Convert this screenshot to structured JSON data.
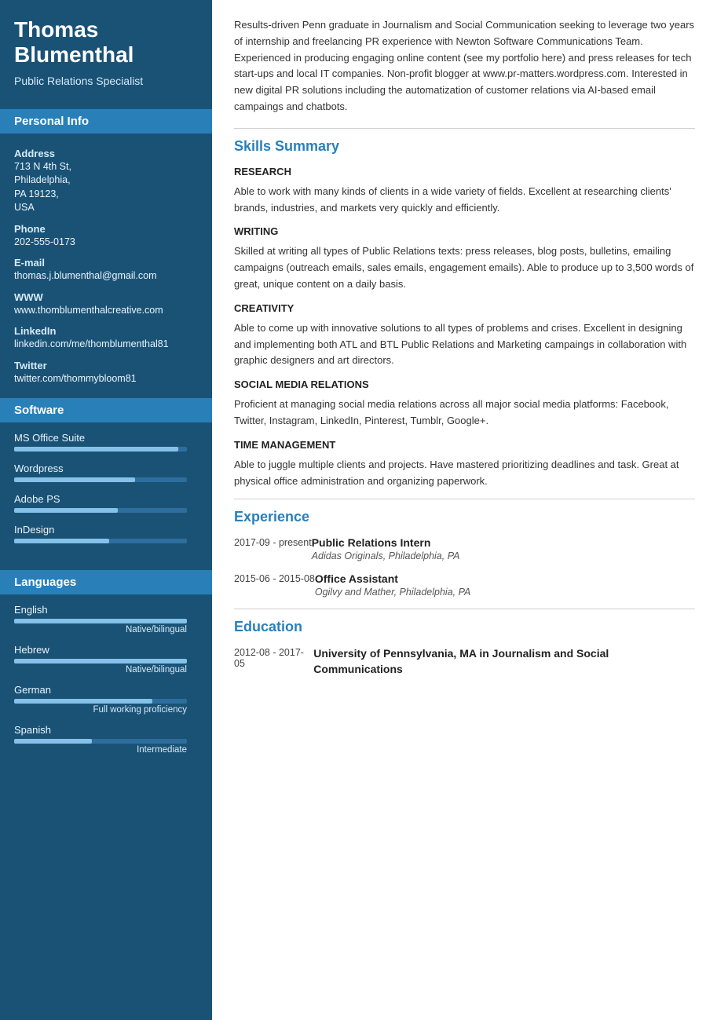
{
  "sidebar": {
    "name": "Thomas Blumenthal",
    "title": "Public Relations Specialist",
    "sections": {
      "personal_info": "Personal Info",
      "software": "Software",
      "languages": "Languages"
    },
    "personal": {
      "address_label": "Address",
      "address_value": "713 N 4th St,\nPhiladelphia,\nPA 19123,\nUSA",
      "phone_label": "Phone",
      "phone_value": "202-555-0173",
      "email_label": "E-mail",
      "email_value": "thomas.j.blumenthal@gmail.com",
      "www_label": "WWW",
      "www_value": "www.thomblumenthalcreative.com",
      "linkedin_label": "LinkedIn",
      "linkedin_value": "linkedin.com/me/thomblumenthal81",
      "twitter_label": "Twitter",
      "twitter_value": "twitter.com/thommybloom81"
    },
    "software": [
      {
        "name": "MS Office Suite",
        "percent": 95
      },
      {
        "name": "Wordpress",
        "percent": 70
      },
      {
        "name": "Adobe PS",
        "percent": 60
      },
      {
        "name": "InDesign",
        "percent": 55
      }
    ],
    "languages": [
      {
        "name": "English",
        "percent": 100,
        "level": "Native/bilingual"
      },
      {
        "name": "Hebrew",
        "percent": 100,
        "level": "Native/bilingual"
      },
      {
        "name": "German",
        "percent": 80,
        "level": "Full working proficiency"
      },
      {
        "name": "Spanish",
        "percent": 45,
        "level": "Intermediate"
      }
    ]
  },
  "main": {
    "summary": "Results-driven Penn graduate in Journalism and Social Communication seeking to leverage two years of internship and freelancing PR experience with Newton Software Communications Team. Experienced in producing engaging online content (see my portfolio here) and press releases for tech start-ups and local IT companies. Non-profit blogger at www.pr-matters.wordpress.com. Interested in new digital PR solutions including the automatization of customer relations via AI-based email campaings and chatbots.",
    "skills_summary_title": "Skills Summary",
    "skills": [
      {
        "label": "RESEARCH",
        "desc": "Able to work with many kinds of clients in a wide variety of fields. Excellent at researching clients' brands, industries, and markets very quickly and efficiently."
      },
      {
        "label": "WRITING",
        "desc": "Skilled at writing all types of Public Relations texts: press releases, blog posts, bulletins, emailing campaigns (outreach emails, sales emails, engagement emails). Able to produce up to 3,500 words of great, unique content on a daily basis."
      },
      {
        "label": "CREATIVITY",
        "desc": "Able to come up with innovative solutions to all types of problems and crises. Excellent in designing and implementing both ATL and BTL Public Relations and Marketing campaings in collaboration with graphic designers and art directors."
      },
      {
        "label": "SOCIAL MEDIA RELATIONS",
        "desc": "Proficient at managing social media relations across all major social media platforms: Facebook, Twitter, Instagram, LinkedIn, Pinterest, Tumblr, Google+."
      },
      {
        "label": "TIME MANAGEMENT",
        "desc": "Able to juggle multiple clients and projects. Have mastered prioritizing deadlines and task. Great at physical office administration and organizing paperwork."
      }
    ],
    "experience_title": "Experience",
    "experience": [
      {
        "date": "2017-09 - present",
        "title": "Public Relations Intern",
        "company": "Adidas Originals, Philadelphia, PA"
      },
      {
        "date": "2015-06 - 2015-08",
        "title": "Office Assistant",
        "company": "Ogilvy and Mather, Philadelphia, PA"
      }
    ],
    "education_title": "Education",
    "education": [
      {
        "date": "2012-08 - 2017-05",
        "title": "University of Pennsylvania, MA in Journalism and Social Communications"
      }
    ]
  }
}
